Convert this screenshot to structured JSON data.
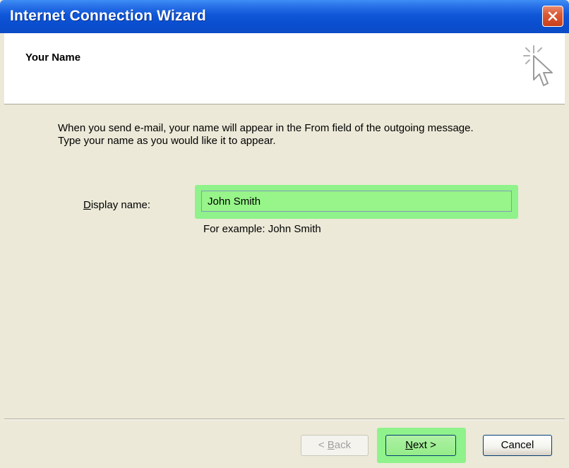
{
  "window": {
    "title": "Internet Connection Wizard"
  },
  "header": {
    "title": "Your Name"
  },
  "intro": {
    "line1": "When you send e-mail, your name will appear in the From field of the outgoing message.",
    "line2": "Type your name as you would like it to appear."
  },
  "display_name": {
    "label_prefix": "D",
    "label_rest": "isplay name:",
    "value": "John Smith",
    "example": "For example: John Smith"
  },
  "buttons": {
    "back_prefix": "< ",
    "back_key": "B",
    "back_rest": "ack",
    "next_key": "N",
    "next_rest": "ext >",
    "cancel": "Cancel"
  },
  "colors": {
    "highlight": "#8ff28a",
    "titlebar": "#0a4fd0",
    "close": "#dc5a36"
  },
  "icons": [
    "close-icon",
    "wizard-cursor-icon"
  ]
}
